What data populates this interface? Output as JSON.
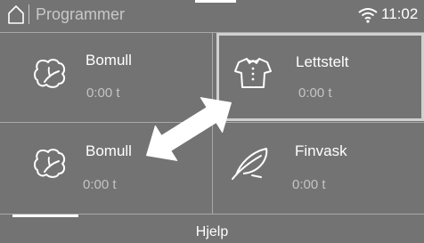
{
  "header": {
    "title": "Programmer",
    "clock": "11:02",
    "home_icon": "home-icon",
    "wifi_icon": "wifi-icon"
  },
  "tiles": [
    {
      "name": "Bomull",
      "time": "0:00 t",
      "icon": "cotton-icon"
    },
    {
      "name": "Lettstelt",
      "time": "0:00 t",
      "icon": "shirt-icon"
    },
    {
      "name": "Bomull",
      "time": "0:00 t",
      "icon": "cotton-icon"
    },
    {
      "name": "Finvask",
      "time": "0:00 t",
      "icon": "feather-icon"
    }
  ],
  "overlay": {
    "icon": "swap-arrow-icon"
  },
  "footer": {
    "help_label": "Hjelp"
  },
  "colors": {
    "background": "#737373",
    "text": "#ffffff",
    "muted_text": "#c4c4c4",
    "divider": "#a8a8a8",
    "selection_border": "#d0d0d0"
  }
}
